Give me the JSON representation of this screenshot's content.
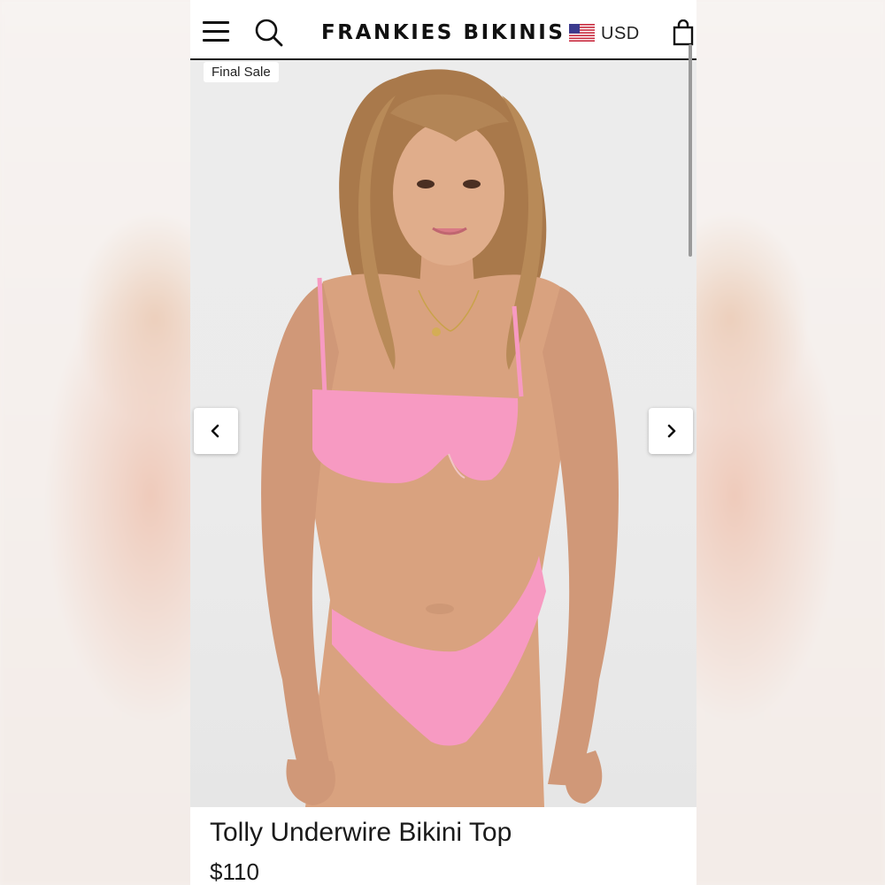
{
  "header": {
    "brand": "FRANKIES BIKINIS",
    "currency": "USD",
    "icons": [
      "menu-icon",
      "search-icon",
      "us-flag-icon",
      "shopping-bag-icon"
    ]
  },
  "gallery": {
    "badge": "Final Sale",
    "prev_icon": "chevron-left-icon",
    "next_icon": "chevron-right-icon"
  },
  "product": {
    "title": "Tolly Underwire Bikini Top",
    "price": "$110",
    "swimsuit_color": "#f79ac2"
  }
}
